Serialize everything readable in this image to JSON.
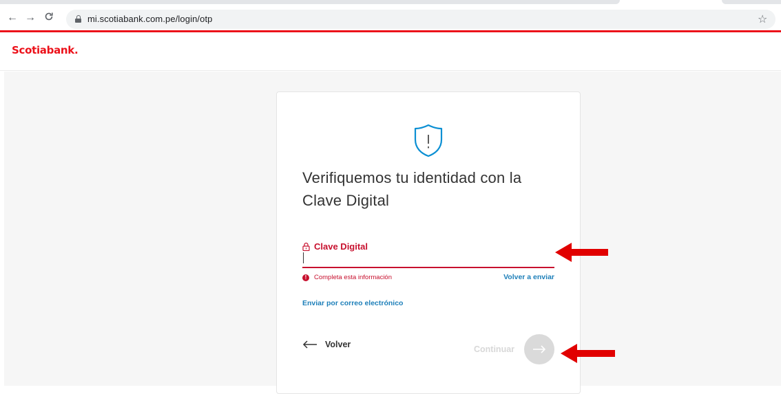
{
  "browser": {
    "url": "mi.scotiabank.com.pe/login/otp",
    "back_icon": "arrow-left-icon",
    "forward_icon": "arrow-right-icon",
    "reload_icon": "reload-icon",
    "bookmark_icon": "star-icon"
  },
  "header": {
    "logo_text": "Scotiabank",
    "logo_dot": "."
  },
  "card": {
    "icon": "shield-alert-icon",
    "title": "Verifiquemos tu identidad con la Clave Digital",
    "field": {
      "label": "Clave Digital",
      "value": "",
      "error": "Completa esta información",
      "icon": "lock-icon"
    },
    "resend_label": "Volver a enviar",
    "email_label": "Enviar por correo electrónico",
    "back_label": "Volver",
    "continue_label": "Continuar"
  },
  "colors": {
    "brand_red": "#ec111a",
    "error_red": "#c7102e",
    "link_blue": "#1d7fb9",
    "shield_blue": "#0b8fd3",
    "annotation_red": "#e10000"
  }
}
